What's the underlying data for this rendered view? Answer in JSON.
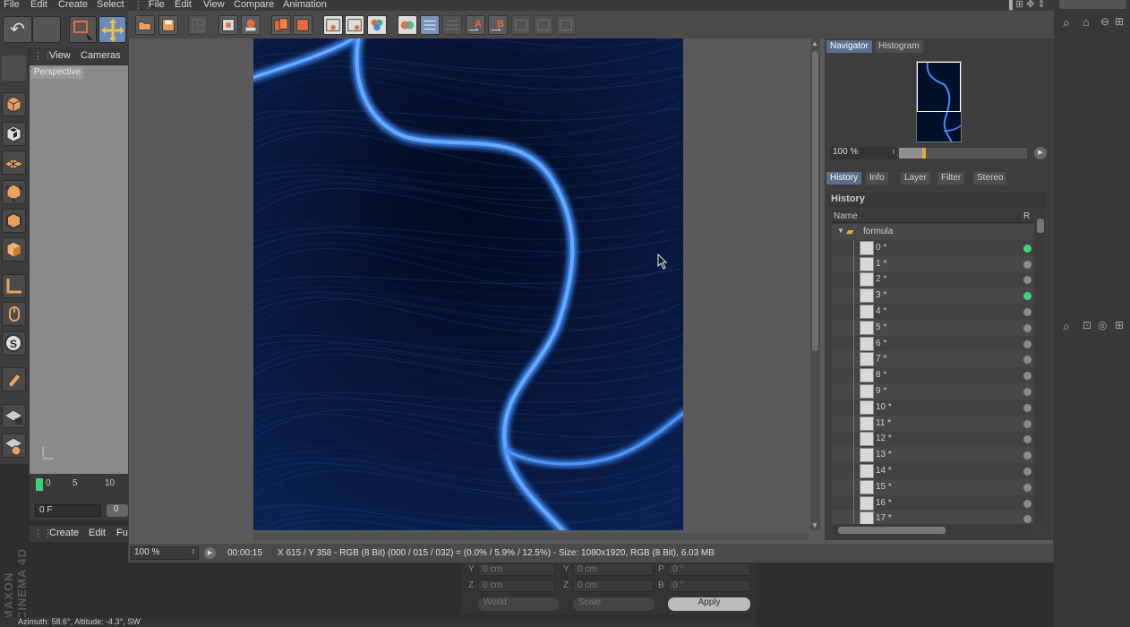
{
  "menu": {
    "main": [
      "File",
      "Edit",
      "Create",
      "Select"
    ],
    "viewer": [
      "File",
      "Edit",
      "View",
      "Compare",
      "Animation"
    ]
  },
  "viewport": {
    "menu": [
      "View",
      "Cameras"
    ],
    "camera_label": "Perspective"
  },
  "timeline": {
    "ticks": [
      "0",
      "5",
      "10"
    ],
    "frame_field": "0 F",
    "frame_field_right": "0"
  },
  "object_manager": {
    "menu": [
      "Create",
      "Edit",
      "Fu"
    ]
  },
  "viewer_status": {
    "zoom": "100 %",
    "time": "00:00:15",
    "info": "X 615 / Y 358 - RGB (8 Bit) (000 / 015 / 032) = (0.0% / 5.9% / 12.5%) - Size: 1080x1920, RGB (8 Bit), 6.03 MB"
  },
  "navigator": {
    "tabs": [
      "Navigator",
      "Histogram"
    ],
    "active_tab": "Navigator",
    "zoom": "100 %",
    "zoom_fraction": 0.18
  },
  "history": {
    "tabs": [
      "History",
      "Info",
      "Layer",
      "Filter",
      "Stereo"
    ],
    "active_tab": "History",
    "title": "History",
    "col_name": "Name",
    "col_r": "R",
    "folder": "formula",
    "items": [
      {
        "label": "0 *",
        "active": true
      },
      {
        "label": "1 *",
        "active": false
      },
      {
        "label": "2 *",
        "active": false
      },
      {
        "label": "3 *",
        "active": true
      },
      {
        "label": "4 *",
        "active": false
      },
      {
        "label": "5 *",
        "active": false
      },
      {
        "label": "6 *",
        "active": false
      },
      {
        "label": "7 *",
        "active": false
      },
      {
        "label": "8 *",
        "active": false
      },
      {
        "label": "9 *",
        "active": false
      },
      {
        "label": "10 *",
        "active": false
      },
      {
        "label": "11 *",
        "active": false
      },
      {
        "label": "12 *",
        "active": false
      },
      {
        "label": "13 *",
        "active": false
      },
      {
        "label": "14 *",
        "active": false
      },
      {
        "label": "15 *",
        "active": false
      },
      {
        "label": "16 *",
        "active": false
      },
      {
        "label": "17 *",
        "active": false
      }
    ]
  },
  "coords": {
    "row1": {
      "a": "Y",
      "av": "0 cm",
      "b": "Y",
      "bv": "0 cm",
      "c": "P",
      "cv": "0 °"
    },
    "row2": {
      "a": "Z",
      "av": "0 cm",
      "b": "Z",
      "bv": "0 cm",
      "c": "B",
      "cv": "0 °"
    },
    "world": "World",
    "scale": "Scale",
    "apply": "Apply"
  },
  "bottom_status": "Azimuth: 58.6°, Altitude: -4.3°, SW",
  "brand": "MAXON CINEMA 4D",
  "colors": {
    "accent": "#5a6f8e",
    "glow": "#3f8cff",
    "active_dot": "#3ed47a"
  }
}
